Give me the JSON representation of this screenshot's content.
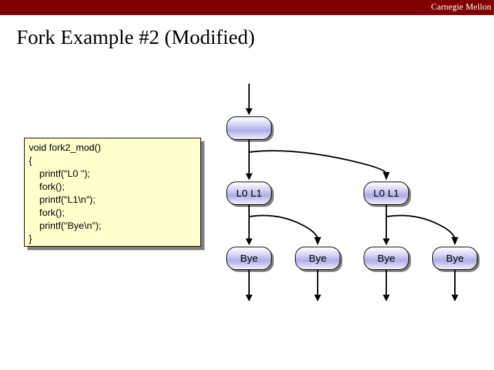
{
  "brand": "Carnegie Mellon",
  "title": "Fork Example #2 (Modified)",
  "code": {
    "l1": "void fork2_mod()",
    "l2": "{",
    "l3": "    printf(\"L0 \");",
    "l4": "    fork();",
    "l5": "    printf(\"L1\\n\");",
    "l6": "    fork();",
    "l7": "    printf(\"Bye\\n\");",
    "l8": "}"
  },
  "nodes": {
    "root": "",
    "l01_a": "L0 L1",
    "l01_b": "L0 L1",
    "bye_1": "Bye",
    "bye_2": "Bye",
    "bye_3": "Bye",
    "bye_4": "Bye"
  }
}
